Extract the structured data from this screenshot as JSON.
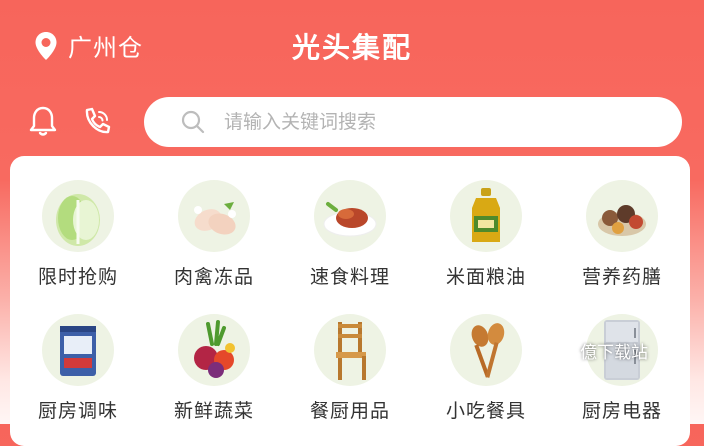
{
  "header": {
    "location": "广州仓",
    "title": "光头集配"
  },
  "search": {
    "placeholder": "请输入关键词搜索"
  },
  "icons": {
    "location": "location-pin-icon",
    "bell": "bell-icon",
    "phone": "phone-icon",
    "search": "search-icon"
  },
  "categories": [
    {
      "label": "限时抢购",
      "icon": "cabbage-icon"
    },
    {
      "label": "肉禽冻品",
      "icon": "chicken-icon"
    },
    {
      "label": "速食料理",
      "icon": "cooked-meat-icon"
    },
    {
      "label": "米面粮油",
      "icon": "oil-bottle-icon"
    },
    {
      "label": "营养药膳",
      "icon": "spices-icon"
    },
    {
      "label": "厨房调味",
      "icon": "seasoning-bag-icon"
    },
    {
      "label": "新鲜蔬菜",
      "icon": "vegetables-icon"
    },
    {
      "label": "餐厨用品",
      "icon": "chair-icon"
    },
    {
      "label": "小吃餐具",
      "icon": "wooden-spoons-icon"
    },
    {
      "label": "厨房电器",
      "icon": "fridge-icon"
    }
  ],
  "watermark": "億下载站",
  "colors": {
    "brand": "#f7655b",
    "background_bottom": "#fff6f5",
    "card": "#ffffff"
  }
}
